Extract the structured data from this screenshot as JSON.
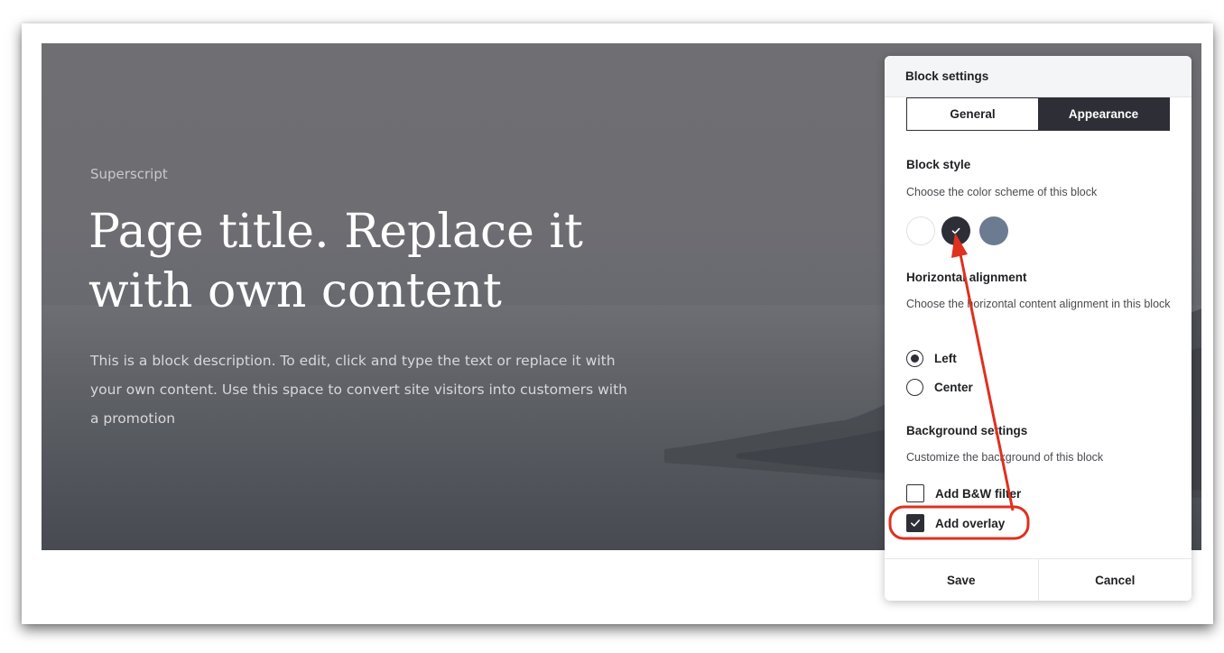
{
  "hero": {
    "superscript": "Superscript",
    "title": "Page title. Replace it with own content",
    "description": "This is a block description. To edit, click and type the text or replace it with your own content. Use this space to convert site visitors into customers with a promotion"
  },
  "panel": {
    "header": "Block settings",
    "tabs": [
      {
        "label": "General",
        "active": false
      },
      {
        "label": "Appearance",
        "active": true
      }
    ],
    "block_style": {
      "title": "Block style",
      "description": "Choose the color scheme of this block",
      "swatches": [
        {
          "color": "#ffffff",
          "selected": false
        },
        {
          "color": "#2e2f36",
          "selected": true
        },
        {
          "color": "#6c7b91",
          "selected": false
        }
      ]
    },
    "horizontal_alignment": {
      "title": "Horizontal alignment",
      "description": "Choose the horizontal content alignment in this block",
      "options": [
        {
          "label": "Left",
          "selected": true
        },
        {
          "label": "Center",
          "selected": false
        }
      ]
    },
    "background_settings": {
      "title": "Background settings",
      "description": "Customize the background of this block",
      "options": [
        {
          "label": "Add B&W filter",
          "checked": false
        },
        {
          "label": "Add overlay",
          "checked": true
        }
      ]
    },
    "footer": {
      "save_label": "Save",
      "cancel_label": "Cancel"
    }
  },
  "colors": {
    "accent_dark": "#2e2f36",
    "annotation_red": "#e0301e"
  },
  "icons": {
    "swatch_check": "check-icon",
    "checkbox_check": "check-icon"
  }
}
